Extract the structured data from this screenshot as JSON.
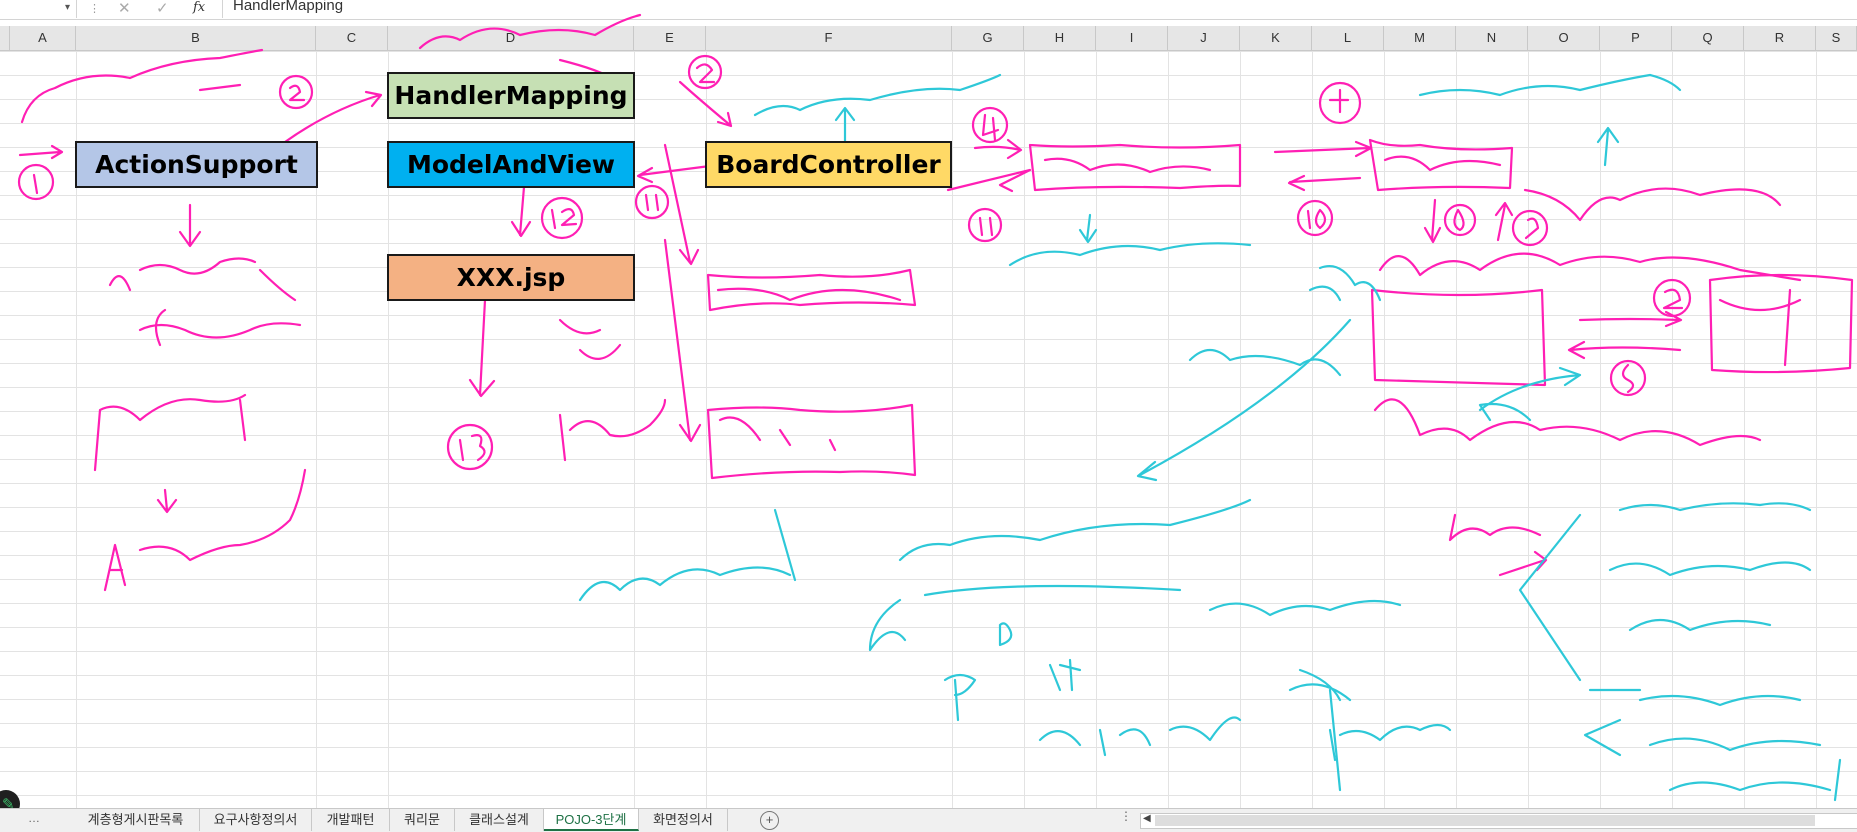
{
  "formula_bar": {
    "name_box": "",
    "cancel_icon": "✕",
    "enter_icon": "✓",
    "fx_label": "fx",
    "content": "HandlerMapping"
  },
  "columns": [
    "A",
    "B",
    "C",
    "D",
    "E",
    "F",
    "G",
    "H",
    "I",
    "J",
    "K",
    "L",
    "M",
    "N",
    "O",
    "P",
    "Q",
    "R",
    "S"
  ],
  "cells": {
    "action_support": "ActionSupport",
    "handler_mapping": "HandlerMapping",
    "model_and_view": "ModelAndView",
    "board_controller": "BoardController",
    "xxx_jsp": "XXX.jsp"
  },
  "colors": {
    "action_support_fill": "#b4c6e7",
    "handler_mapping_fill": "#c6e0b4",
    "model_and_view_fill": "#00b0f0",
    "board_controller_fill": "#ffd966",
    "xxx_jsp_fill": "#f4b183",
    "pink_ink": "#ff1fb4",
    "cyan_ink": "#2ec8d8",
    "active_tab": "#1e7145"
  },
  "sheet_tabs": [
    "계층형게시판목록",
    "요구사항정의서",
    "개발패턴",
    "쿼리문",
    "클래스설계",
    "POJO-3단계",
    "화면정의서"
  ],
  "active_tab": "POJO-3단계",
  "add_sheet_icon": "+"
}
